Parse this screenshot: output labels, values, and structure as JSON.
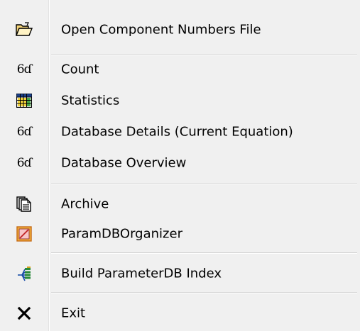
{
  "menu": {
    "items": [
      {
        "label": "Open Component Numbers File",
        "icon": "folder-open-icon"
      },
      {
        "label": "Count",
        "icon": "glasses-icon"
      },
      {
        "label": "Statistics",
        "icon": "spreadsheet-icon"
      },
      {
        "label": "Database Details (Current Equation)",
        "icon": "glasses-icon"
      },
      {
        "label": "Database Overview",
        "icon": "glasses-icon"
      },
      {
        "label": "Archive",
        "icon": "archive-documents-icon"
      },
      {
        "label": "ParamDBOrganizer",
        "icon": "organizer-icon"
      },
      {
        "label": "Build ParameterDB Index",
        "icon": "tree-index-icon"
      },
      {
        "label": "Exit",
        "icon": "close-x-icon"
      }
    ]
  },
  "icons": {
    "glasses_glyph": "6ɗ"
  }
}
